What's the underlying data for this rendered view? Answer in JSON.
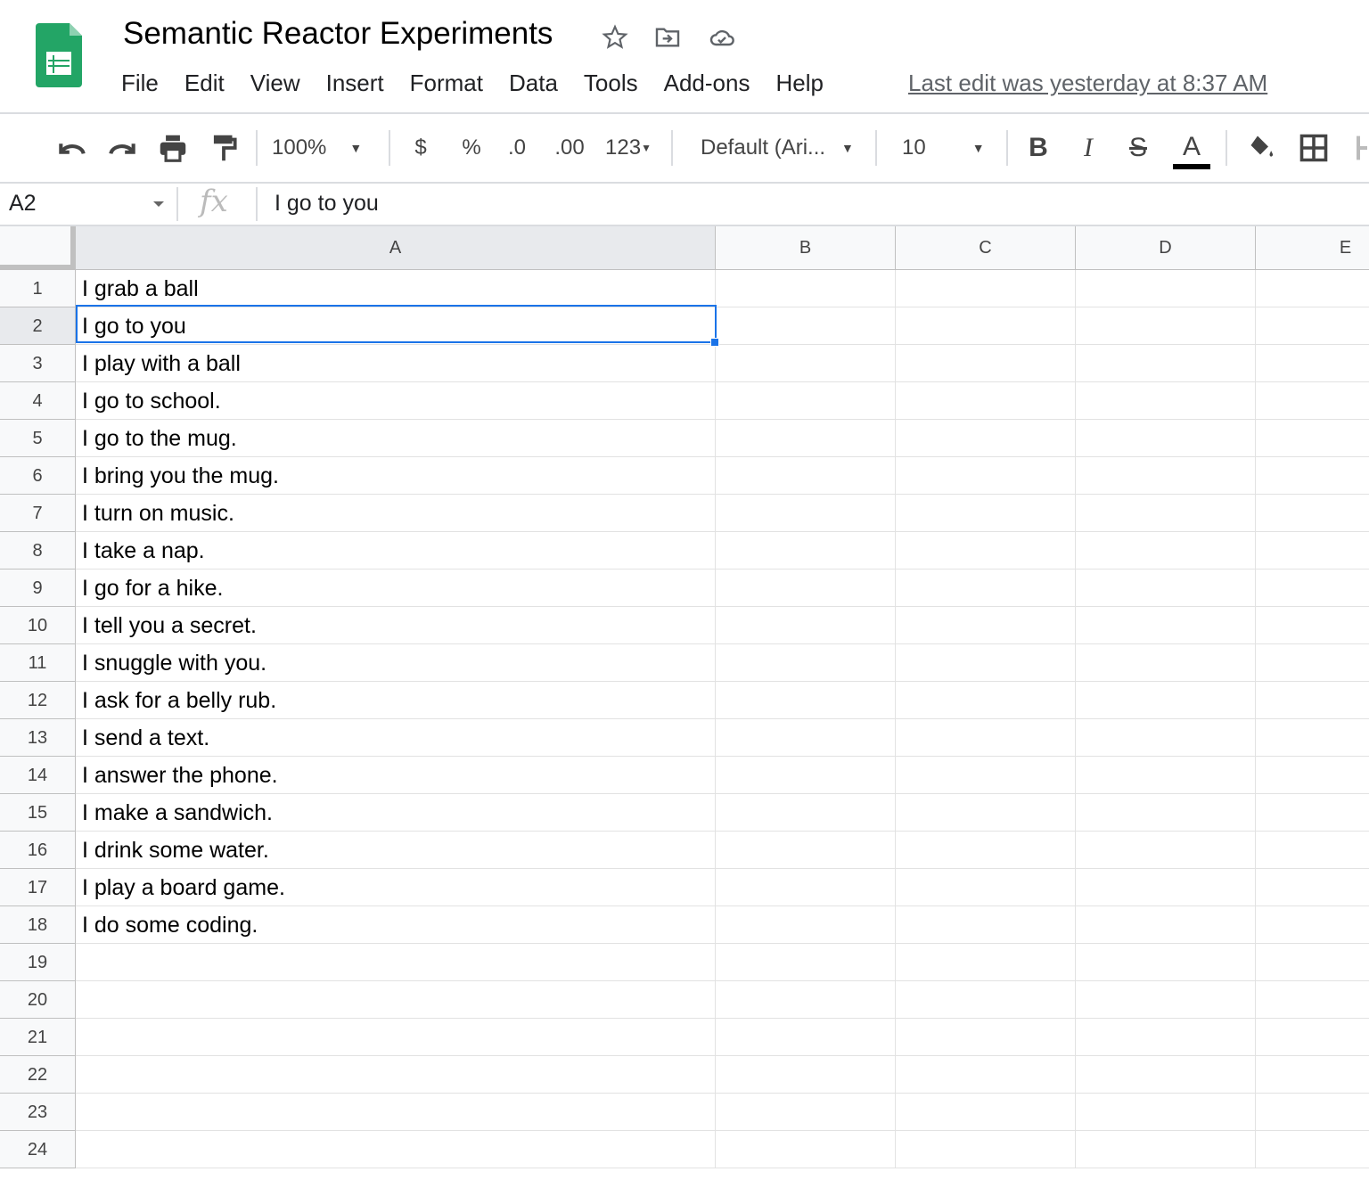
{
  "app": {
    "title": "Semantic Reactor Experiments",
    "last_edit": "Last edit was yesterday at 8:37 AM",
    "accent": "#1a73e8",
    "logo_color": "#0f9d58"
  },
  "title_icons": [
    "star-icon",
    "move-to-folder-icon",
    "cloud-saved-icon"
  ],
  "menu": [
    "File",
    "Edit",
    "View",
    "Insert",
    "Format",
    "Data",
    "Tools",
    "Add-ons",
    "Help"
  ],
  "toolbar": {
    "zoom": "100%",
    "currency": "$",
    "percent": "%",
    "dec_decrease": ".0",
    "dec_increase": ".00",
    "more_formats": "123",
    "font": "Default (Ari...",
    "font_size": "10",
    "bold": "B",
    "italic": "I",
    "strike": "S",
    "text_color": "A"
  },
  "formula_bar": {
    "cell_ref": "A2",
    "fx": "fx",
    "value": "I go to you"
  },
  "columns": [
    "A",
    "B",
    "C",
    "D",
    "E"
  ],
  "selected": {
    "row": 2,
    "col": "A"
  },
  "rows": [
    "I grab a ball",
    "I go to you",
    "I play with a ball",
    "I go to school.",
    "I go to the mug.",
    "I bring you the mug.",
    "I turn on music.",
    "I take a nap.",
    "I go for a hike.",
    "I tell you a secret.",
    "I snuggle with you.",
    "I ask for a belly rub.",
    "I send a text.",
    "I answer the phone.",
    "I make a sandwich.",
    "I drink some water.",
    "I play a board game.",
    "I do some coding.",
    "",
    "",
    "",
    "",
    "",
    ""
  ]
}
